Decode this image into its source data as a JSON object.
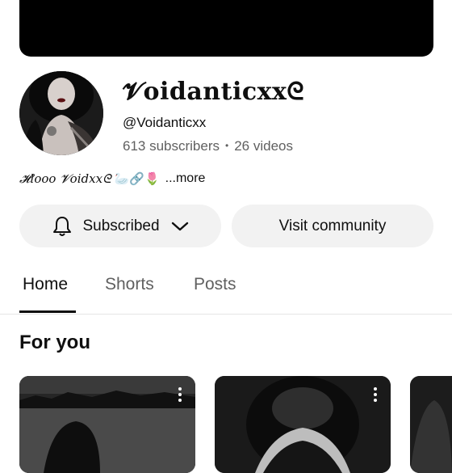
{
  "channel": {
    "name": "𝓥oidanticxxᘓ",
    "handle": "@Voidanticxx",
    "subscribers": "613 subscribers",
    "separator": "•",
    "videos": "26 videos",
    "description_name": "𝓗looo 𝓥oidxxᘓ",
    "description_emojis": "🦢🔗🌷",
    "more_label": "...more"
  },
  "actions": {
    "subscribed_label": "Subscribed",
    "community_label": "Visit community"
  },
  "tabs": [
    {
      "label": "Home",
      "active": true
    },
    {
      "label": "Shorts",
      "active": false
    },
    {
      "label": "Posts",
      "active": false
    }
  ],
  "section": {
    "title": "For you"
  },
  "icons": {
    "bell": "bell-icon",
    "chevron": "chevron-down-icon",
    "more": "more-vert-icon"
  },
  "colors": {
    "button_bg": "#f2f2f2",
    "secondary_text": "#606060"
  }
}
